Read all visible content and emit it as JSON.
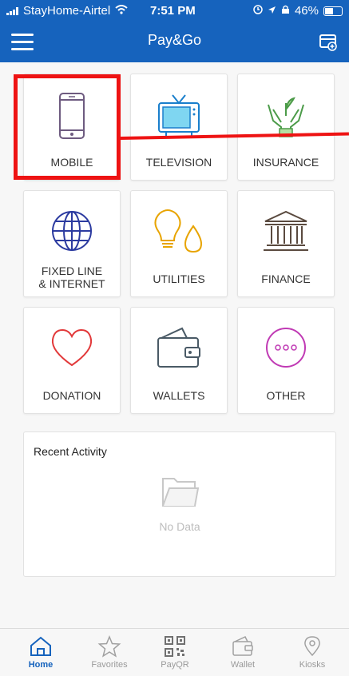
{
  "status_bar": {
    "carrier": "StayHome-Airtel",
    "time": "7:51 PM",
    "battery": "46%"
  },
  "app_bar": {
    "title": "Pay&Go"
  },
  "tiles": [
    {
      "label": "MOBILE",
      "icon": "mobile-phone-icon",
      "highlighted": true
    },
    {
      "label": "TELEVISION",
      "icon": "television-icon"
    },
    {
      "label": "INSURANCE",
      "icon": "insurance-hands-icon"
    },
    {
      "label": "FIXED LINE\n& INTERNET",
      "icon": "globe-icon"
    },
    {
      "label": "UTILITIES",
      "icon": "bulb-drop-icon"
    },
    {
      "label": "FINANCE",
      "icon": "bank-icon"
    },
    {
      "label": "DONATION",
      "icon": "heart-icon"
    },
    {
      "label": "WALLETS",
      "icon": "wallet-icon"
    },
    {
      "label": "OTHER",
      "icon": "more-icon"
    }
  ],
  "recent_activity": {
    "title": "Recent Activity",
    "empty_text": "No Data"
  },
  "bottom_nav": [
    {
      "label": "Home",
      "icon": "home-icon",
      "active": true
    },
    {
      "label": "Favorites",
      "icon": "star-icon"
    },
    {
      "label": "PayQR",
      "icon": "qr-icon"
    },
    {
      "label": "Wallet",
      "icon": "wallet-icon"
    },
    {
      "label": "Kiosks",
      "icon": "location-pin-icon"
    }
  ],
  "colors": {
    "primary": "#1663bd",
    "highlight": "#ee1313"
  }
}
